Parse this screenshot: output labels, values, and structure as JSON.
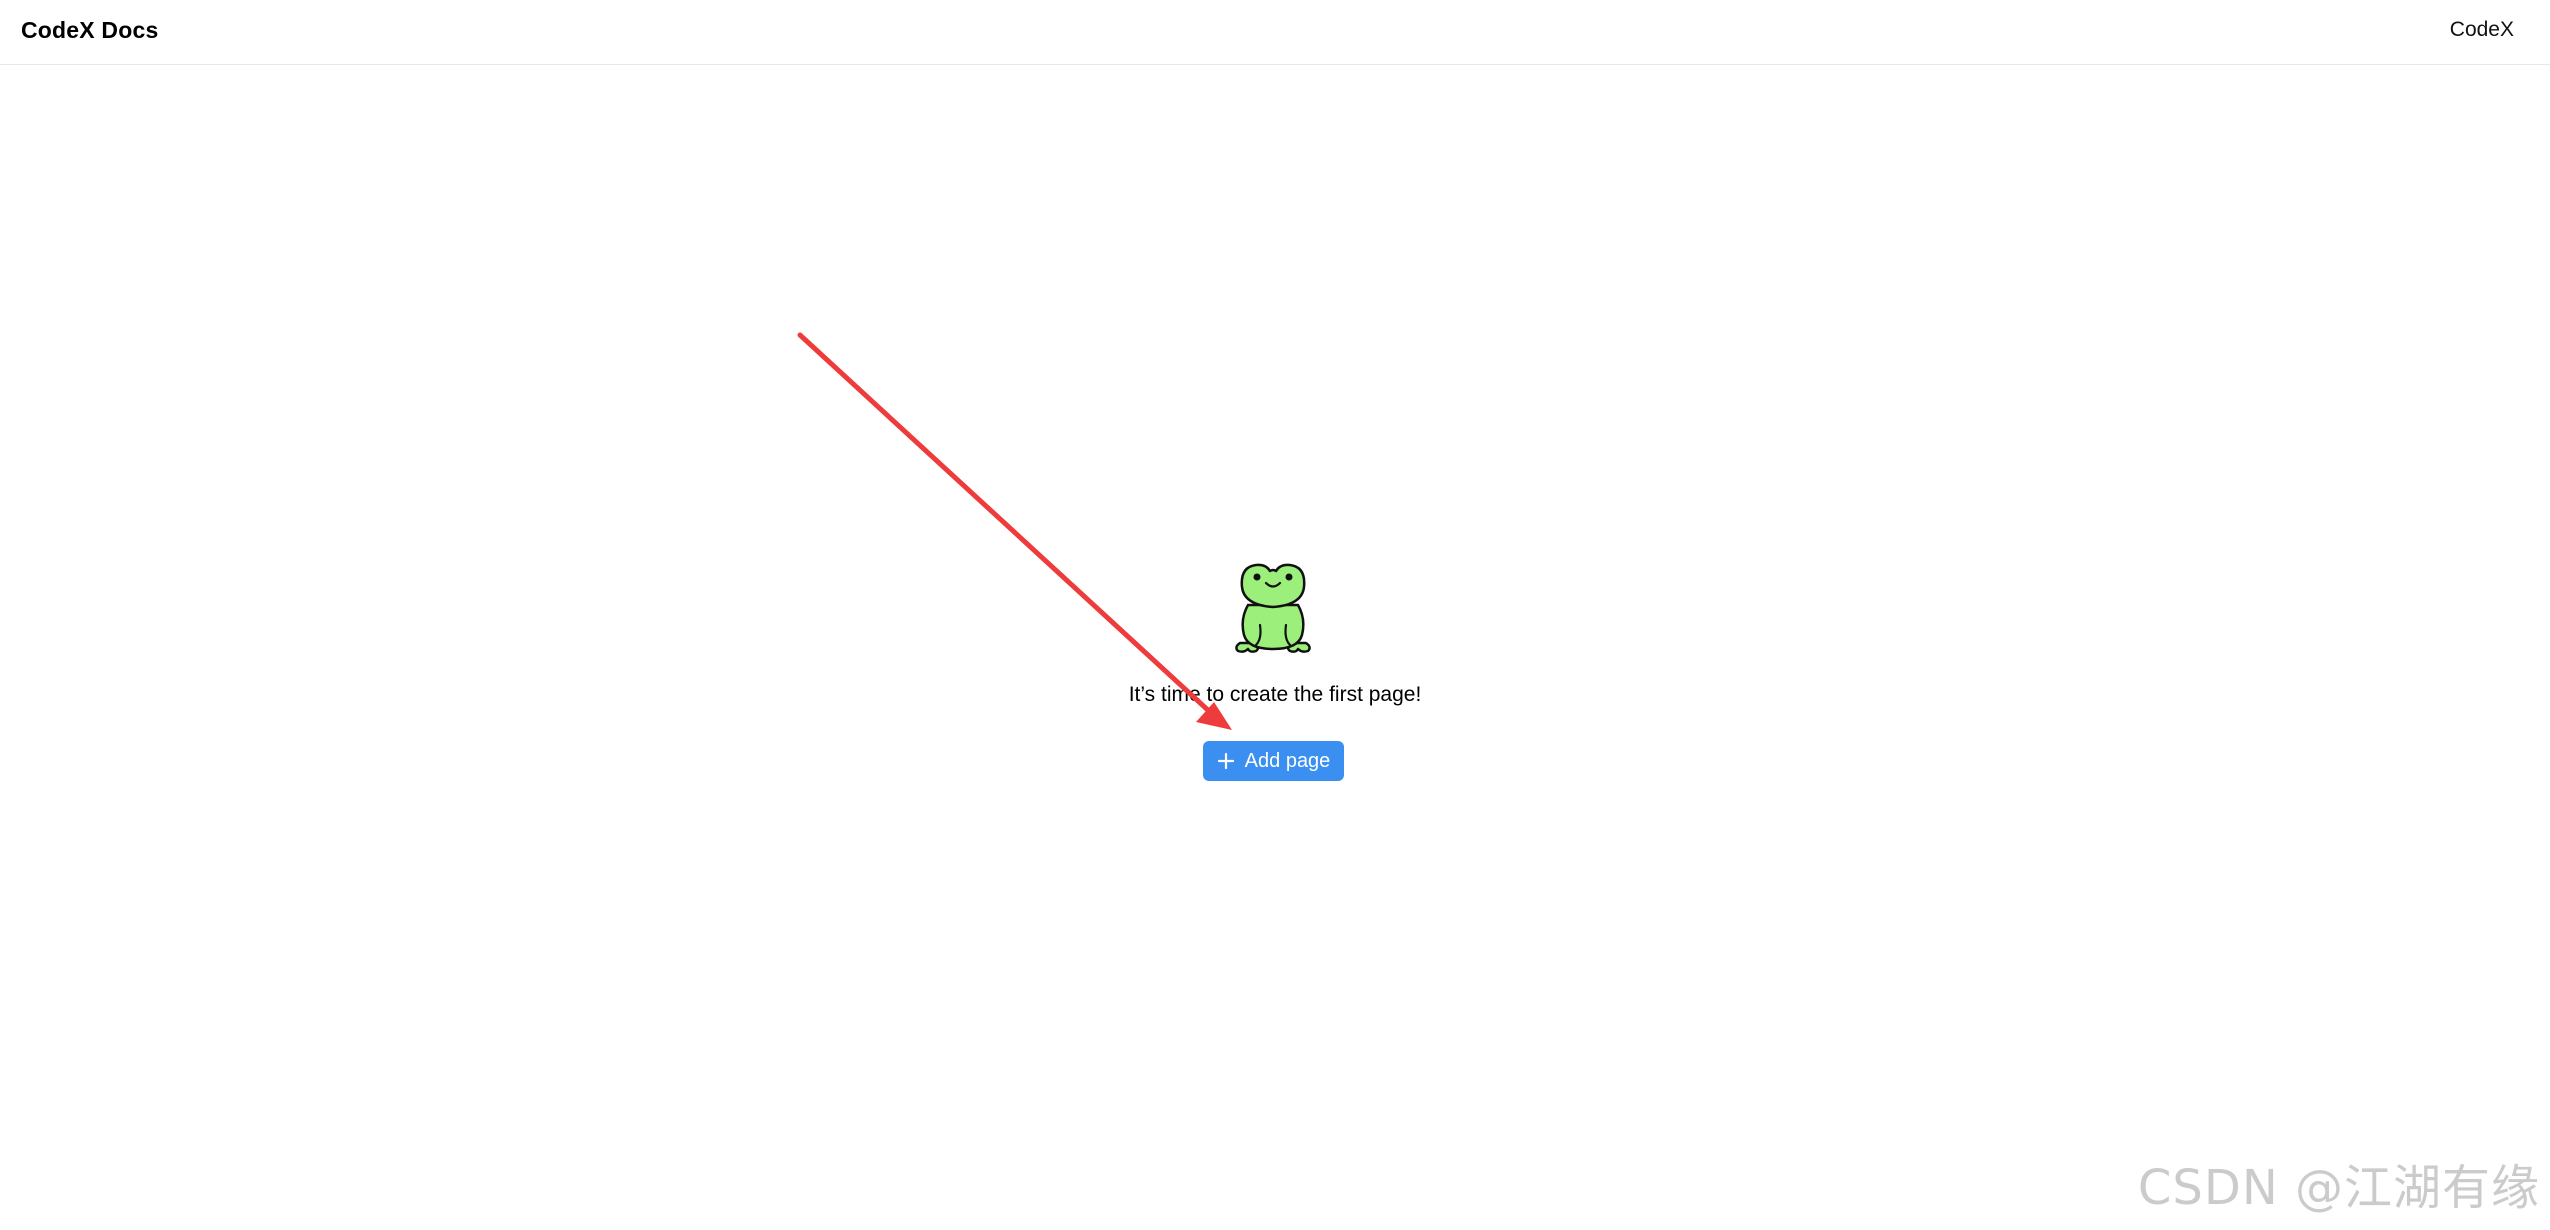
{
  "header": {
    "brand": "CodeX Docs",
    "link": "CodeX"
  },
  "empty_state": {
    "illustration_icon": "frog-icon",
    "message": "It’s time to create the first page!",
    "button_label": "Add page",
    "button_icon": "plus-icon",
    "button_color": "#3b8ff0"
  },
  "annotation": {
    "arrow_color": "#ee3b3b"
  },
  "watermark": "CSDN @江湖有缘"
}
